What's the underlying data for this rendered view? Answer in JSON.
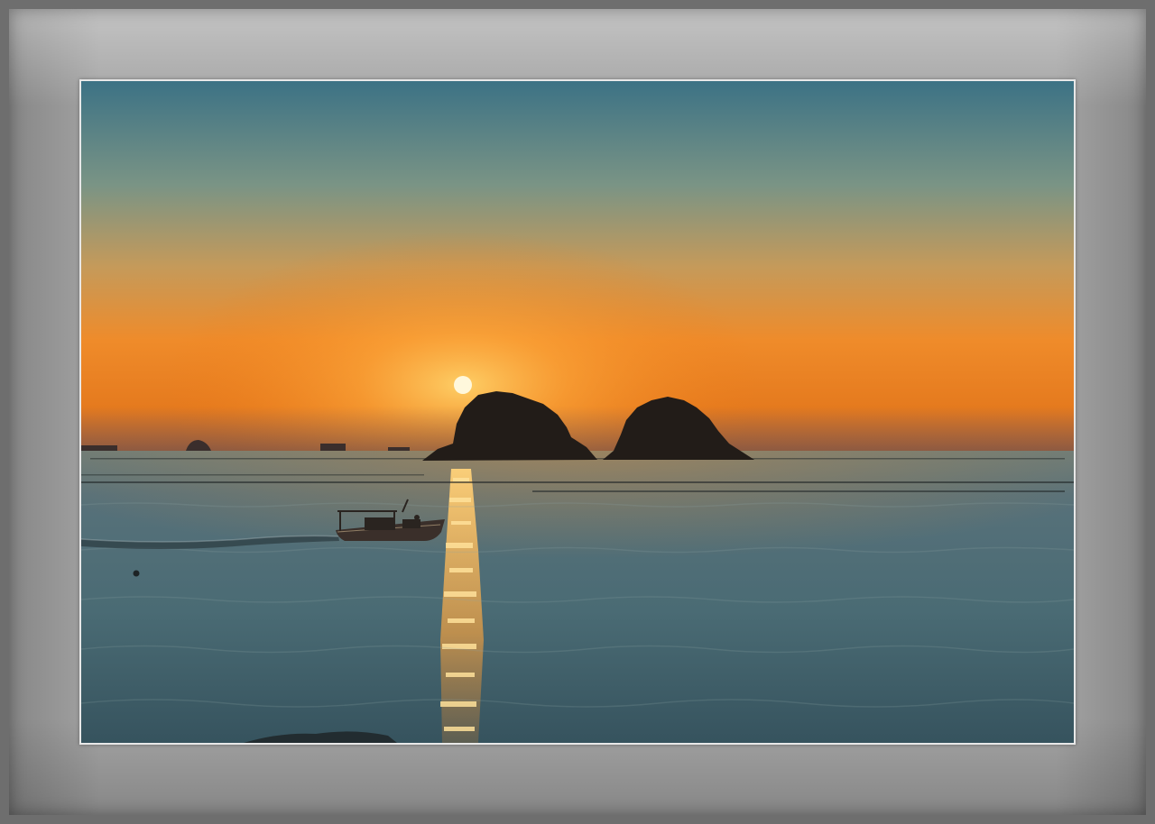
{
  "scene": {
    "subject": "sunset-over-sea",
    "colors": {
      "sky_top": "#3f7485",
      "sky_mid": "#8a9a6e",
      "sky_glow": "#f29a2e",
      "horizon_glow": "#f07a14",
      "sea": "#4a6a70",
      "sea_reflection": "#d99a4c",
      "sun": "#fff7d6",
      "silhouette": "#1e1a17",
      "frame_outer": "#6e6e6e",
      "mat": "#a4a4a4",
      "photo_border": "#e8e8e8"
    }
  }
}
